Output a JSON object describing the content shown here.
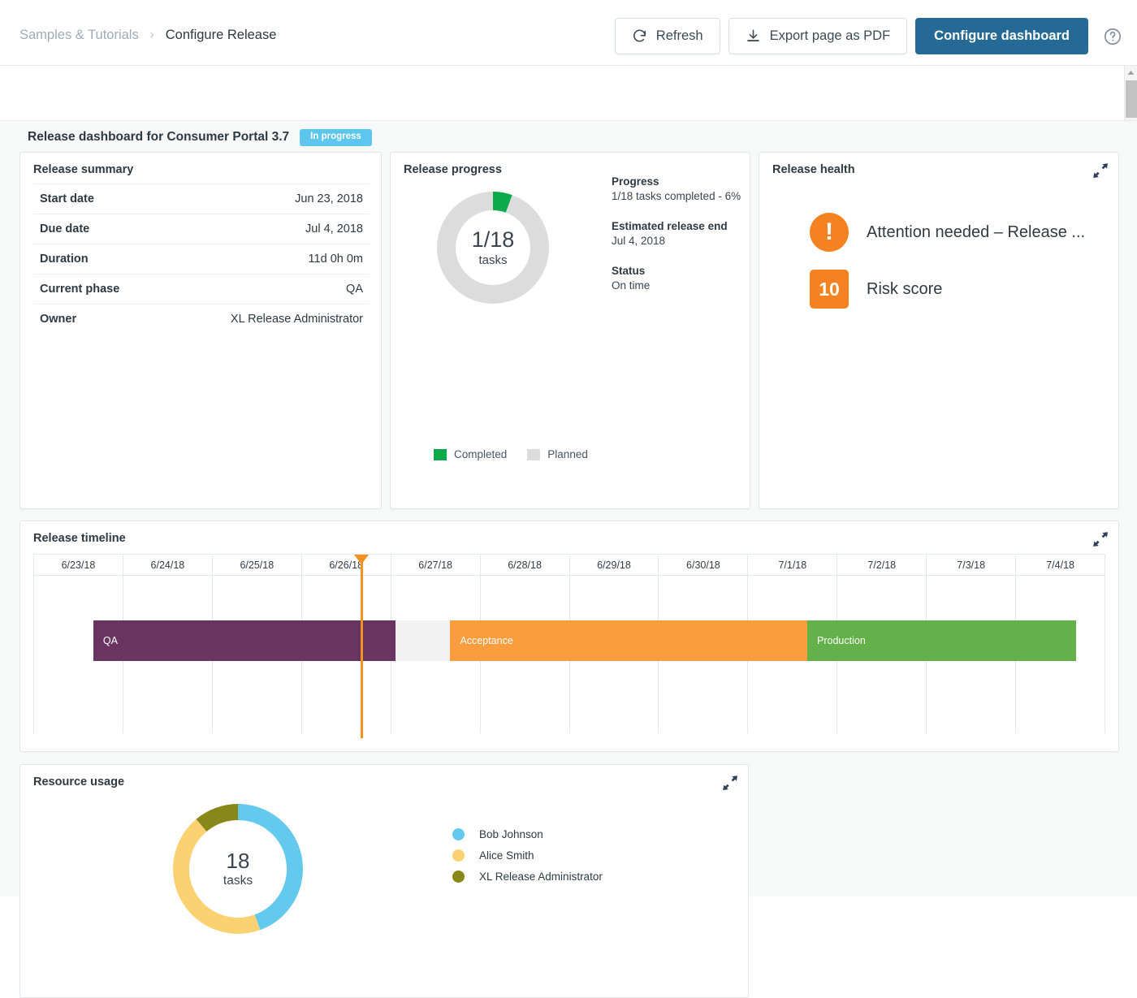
{
  "header": {
    "breadcrumb": {
      "parent": "Samples & Tutorials",
      "separator": "›",
      "current": "Configure Release"
    },
    "refresh_label": "Refresh",
    "export_label": "Export page as PDF",
    "configure_label": "Configure dashboard",
    "help_icon": "help-circle-icon",
    "primary_color": "#246a94"
  },
  "dashboard": {
    "title": "Release dashboard for Consumer Portal 3.7",
    "status_badge": "In progress",
    "badge_color": "#5cc6ef"
  },
  "summary": {
    "title": "Release summary",
    "rows": [
      {
        "key": "Start date",
        "value": "Jun 23, 2018"
      },
      {
        "key": "Due date",
        "value": "Jul 4, 2018"
      },
      {
        "key": "Duration",
        "value": "11d 0h 0m"
      },
      {
        "key": "Current phase",
        "value": "QA"
      },
      {
        "key": "Owner",
        "value": "XL Release Administrator"
      }
    ]
  },
  "progress": {
    "title": "Release progress",
    "donut_value": "1/18",
    "donut_unit": "tasks",
    "legend": [
      {
        "label": "Completed",
        "color": "#0caa4a"
      },
      {
        "label": "Planned",
        "color": "#dcdcdc"
      }
    ],
    "info": [
      {
        "label": "Progress",
        "value": "1/18 tasks completed - 6%"
      },
      {
        "label": "Estimated release end",
        "value": "Jul 4, 2018"
      },
      {
        "label": "Status",
        "value": "On time"
      }
    ],
    "chart_data": {
      "type": "pie",
      "title": "Release progress",
      "categories": [
        "Completed",
        "Planned"
      ],
      "values": [
        1,
        17
      ],
      "colors": [
        "#0caa4a",
        "#dcdcdc"
      ],
      "total": 18,
      "percent_complete": 6,
      "center_label": "1/18 tasks",
      "legend_position": "bottom-left"
    }
  },
  "health": {
    "title": "Release health",
    "expand_icon": "expand-diagonal-icon",
    "items": [
      {
        "icon": "exclamation-circle-icon",
        "icon_text": "!",
        "label": "Attention needed – Release ...",
        "color": "#f58220",
        "shape": "circle"
      },
      {
        "icon": "risk-score-badge",
        "icon_text": "10",
        "label": "Risk score",
        "color": "#f58220",
        "shape": "square"
      }
    ]
  },
  "timeline": {
    "title": "Release timeline",
    "expand_icon": "expand-diagonal-icon",
    "columns": [
      "6/23/18",
      "6/24/18",
      "6/25/18",
      "6/26/18",
      "6/27/18",
      "6/28/18",
      "6/29/18",
      "6/30/18",
      "7/1/18",
      "7/2/18",
      "7/3/18",
      "7/4/18"
    ],
    "marker_position_pct": 30.5,
    "marker_color": "#f3921e",
    "bars": [
      {
        "label": "QA",
        "color": "#6a3461",
        "start_pct": 5.6,
        "width_pct": 28.2
      },
      {
        "label": "",
        "color": "#f2f2f2",
        "start_pct": 33.8,
        "width_pct": 5.1
      },
      {
        "label": "Acceptance",
        "color": "#f99d3e",
        "start_pct": 38.9,
        "width_pct": 33.3
      },
      {
        "label": "Production",
        "color": "#64b04a",
        "start_pct": 72.2,
        "width_pct": 25.1
      }
    ]
  },
  "resource": {
    "title": "Resource usage",
    "expand_icon": "expand-diagonal-icon",
    "donut_value": "18",
    "donut_unit": "tasks",
    "chart_data": {
      "type": "pie",
      "title": "Resource usage",
      "categories": [
        "Bob Johnson",
        "Alice Smith",
        "XL Release Administrator"
      ],
      "values": [
        8,
        8,
        2
      ],
      "colors": [
        "#63c9ed",
        "#fcd171",
        "#88881a"
      ],
      "total": 18,
      "center_label": "18 tasks",
      "legend_position": "right"
    },
    "legend": [
      {
        "label": "Bob Johnson",
        "color": "#63c9ed"
      },
      {
        "label": "Alice Smith",
        "color": "#fcd171"
      },
      {
        "label": "XL Release Administrator",
        "color": "#88881a"
      }
    ]
  }
}
